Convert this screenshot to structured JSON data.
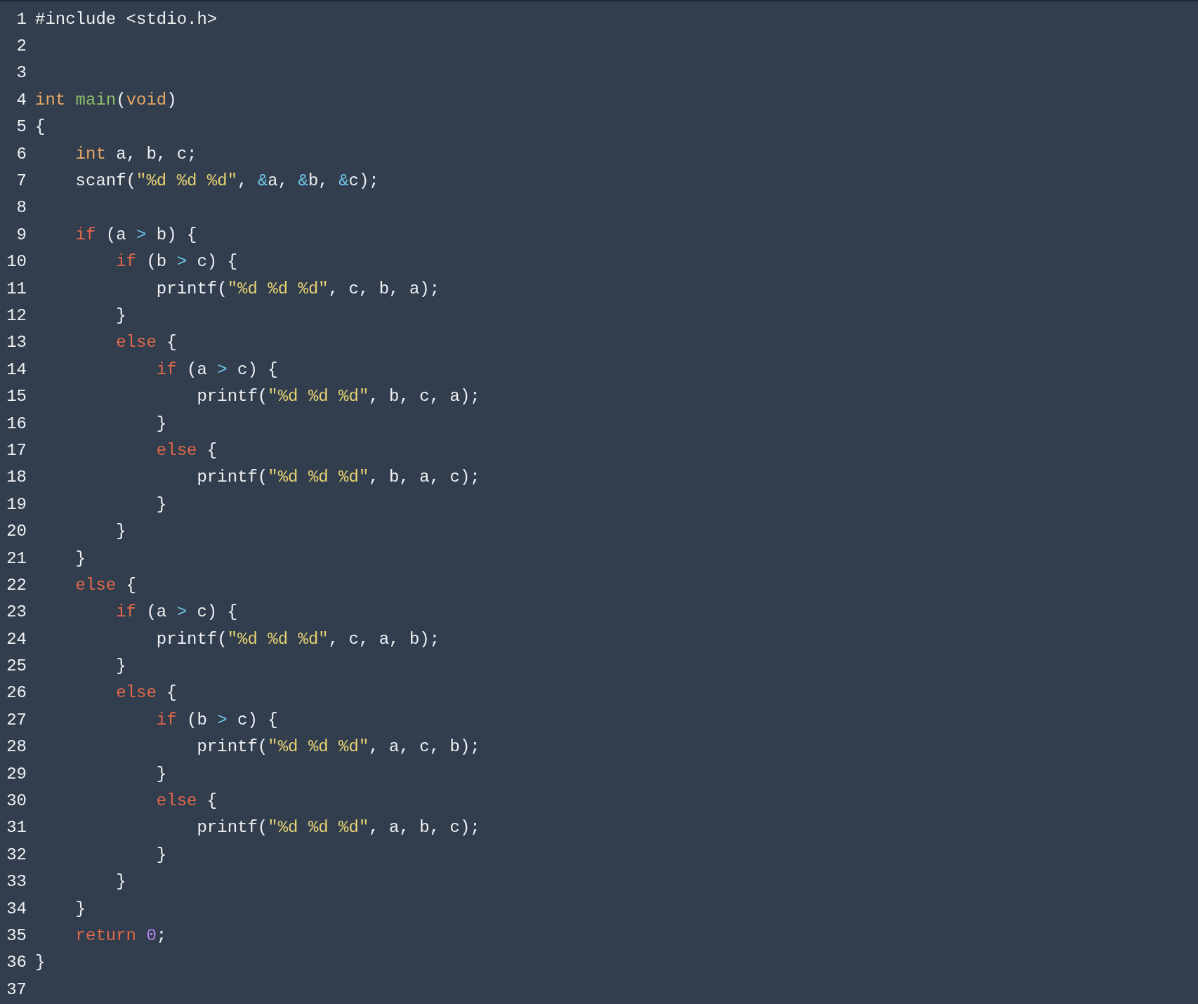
{
  "editor": {
    "lines": [
      {
        "number": "1",
        "tokens": [
          {
            "text": "#include <stdio.h>",
            "kind": "plain"
          }
        ]
      },
      {
        "number": "2"
      },
      {
        "number": "3"
      },
      {
        "number": "4",
        "tokens": [
          {
            "text": "int ",
            "kind": "type"
          },
          {
            "text": "main",
            "kind": "function"
          },
          {
            "text": "(",
            "kind": "plain"
          },
          {
            "text": "void",
            "kind": "type"
          },
          {
            "text": ")",
            "kind": "plain"
          }
        ]
      },
      {
        "number": "5",
        "tokens": [
          {
            "text": "{",
            "kind": "plain"
          }
        ]
      },
      {
        "number": "6",
        "tokens": [
          {
            "text": "    int",
            "kind": "type"
          },
          {
            "text": " a, b, c;",
            "kind": "plain"
          }
        ]
      },
      {
        "number": "7",
        "tokens": [
          {
            "text": "    scanf(",
            "kind": "plain"
          },
          {
            "text": "\"%d %d %d\"",
            "kind": "string"
          },
          {
            "text": ", ",
            "kind": "plain"
          },
          {
            "text": "&",
            "kind": "operator"
          },
          {
            "text": "a, ",
            "kind": "plain"
          },
          {
            "text": "&",
            "kind": "operator"
          },
          {
            "text": "b, ",
            "kind": "plain"
          },
          {
            "text": "&",
            "kind": "operator"
          },
          {
            "text": "c);",
            "kind": "plain"
          }
        ]
      },
      {
        "number": "8"
      },
      {
        "number": "9",
        "tokens": [
          {
            "text": "    if",
            "kind": "keyword"
          },
          {
            "text": " (a ",
            "kind": "plain"
          },
          {
            "text": ">",
            "kind": "operator"
          },
          {
            "text": " b) {",
            "kind": "plain"
          }
        ]
      },
      {
        "number": "10",
        "tokens": [
          {
            "text": "        if",
            "kind": "keyword"
          },
          {
            "text": " (b ",
            "kind": "plain"
          },
          {
            "text": ">",
            "kind": "operator"
          },
          {
            "text": " c) {",
            "kind": "plain"
          }
        ]
      },
      {
        "number": "11",
        "tokens": [
          {
            "text": "            printf(",
            "kind": "plain"
          },
          {
            "text": "\"%d %d %d\"",
            "kind": "string"
          },
          {
            "text": ", c, b, a);",
            "kind": "plain"
          }
        ]
      },
      {
        "number": "12",
        "tokens": [
          {
            "text": "        }",
            "kind": "plain"
          }
        ]
      },
      {
        "number": "13",
        "tokens": [
          {
            "text": "        else",
            "kind": "keyword"
          },
          {
            "text": " {",
            "kind": "plain"
          }
        ]
      },
      {
        "number": "14",
        "tokens": [
          {
            "text": "            if",
            "kind": "keyword"
          },
          {
            "text": " (a ",
            "kind": "plain"
          },
          {
            "text": ">",
            "kind": "operator"
          },
          {
            "text": " c) {",
            "kind": "plain"
          }
        ]
      },
      {
        "number": "15",
        "tokens": [
          {
            "text": "                printf(",
            "kind": "plain"
          },
          {
            "text": "\"%d %d %d\"",
            "kind": "string"
          },
          {
            "text": ", b, c, a);",
            "kind": "plain"
          }
        ]
      },
      {
        "number": "16",
        "tokens": [
          {
            "text": "            }",
            "kind": "plain"
          }
        ]
      },
      {
        "number": "17",
        "tokens": [
          {
            "text": "            else",
            "kind": "keyword"
          },
          {
            "text": " {",
            "kind": "plain"
          }
        ]
      },
      {
        "number": "18",
        "tokens": [
          {
            "text": "                printf(",
            "kind": "plain"
          },
          {
            "text": "\"%d %d %d\"",
            "kind": "string"
          },
          {
            "text": ", b, a, c);",
            "kind": "plain"
          }
        ]
      },
      {
        "number": "19",
        "tokens": [
          {
            "text": "            }",
            "kind": "plain"
          }
        ]
      },
      {
        "number": "20",
        "tokens": [
          {
            "text": "        }",
            "kind": "plain"
          }
        ]
      },
      {
        "number": "21",
        "tokens": [
          {
            "text": "    }",
            "kind": "plain"
          }
        ]
      },
      {
        "number": "22",
        "tokens": [
          {
            "text": "    else",
            "kind": "keyword"
          },
          {
            "text": " {",
            "kind": "plain"
          }
        ]
      },
      {
        "number": "23",
        "tokens": [
          {
            "text": "        if",
            "kind": "keyword"
          },
          {
            "text": " (a ",
            "kind": "plain"
          },
          {
            "text": ">",
            "kind": "operator"
          },
          {
            "text": " c) {",
            "kind": "plain"
          }
        ]
      },
      {
        "number": "24",
        "tokens": [
          {
            "text": "            printf(",
            "kind": "plain"
          },
          {
            "text": "\"%d %d %d\"",
            "kind": "string"
          },
          {
            "text": ", c, a, b);",
            "kind": "plain"
          }
        ]
      },
      {
        "number": "25",
        "tokens": [
          {
            "text": "        }",
            "kind": "plain"
          }
        ]
      },
      {
        "number": "26",
        "tokens": [
          {
            "text": "        else",
            "kind": "keyword"
          },
          {
            "text": " {",
            "kind": "plain"
          }
        ]
      },
      {
        "number": "27",
        "tokens": [
          {
            "text": "            if",
            "kind": "keyword"
          },
          {
            "text": " (b ",
            "kind": "plain"
          },
          {
            "text": ">",
            "kind": "operator"
          },
          {
            "text": " c) {",
            "kind": "plain"
          }
        ]
      },
      {
        "number": "28",
        "tokens": [
          {
            "text": "                printf(",
            "kind": "plain"
          },
          {
            "text": "\"%d %d %d\"",
            "kind": "string"
          },
          {
            "text": ", a, c, b);",
            "kind": "plain"
          }
        ]
      },
      {
        "number": "29",
        "tokens": [
          {
            "text": "            }",
            "kind": "plain"
          }
        ]
      },
      {
        "number": "30",
        "tokens": [
          {
            "text": "            else",
            "kind": "keyword"
          },
          {
            "text": " {",
            "kind": "plain"
          }
        ]
      },
      {
        "number": "31",
        "tokens": [
          {
            "text": "                printf(",
            "kind": "plain"
          },
          {
            "text": "\"%d %d %d\"",
            "kind": "string"
          },
          {
            "text": ", a, b, c);",
            "kind": "plain"
          }
        ]
      },
      {
        "number": "32",
        "tokens": [
          {
            "text": "            }",
            "kind": "plain"
          }
        ]
      },
      {
        "number": "33",
        "tokens": [
          {
            "text": "        }",
            "kind": "plain"
          }
        ]
      },
      {
        "number": "34",
        "tokens": [
          {
            "text": "    }",
            "kind": "plain"
          }
        ]
      },
      {
        "number": "35",
        "tokens": [
          {
            "text": "    return ",
            "kind": "keyword"
          },
          {
            "text": "0",
            "kind": "number"
          },
          {
            "text": ";",
            "kind": "plain"
          }
        ]
      },
      {
        "number": "36",
        "tokens": [
          {
            "text": "}",
            "kind": "plain"
          }
        ]
      },
      {
        "number": "37"
      }
    ]
  }
}
